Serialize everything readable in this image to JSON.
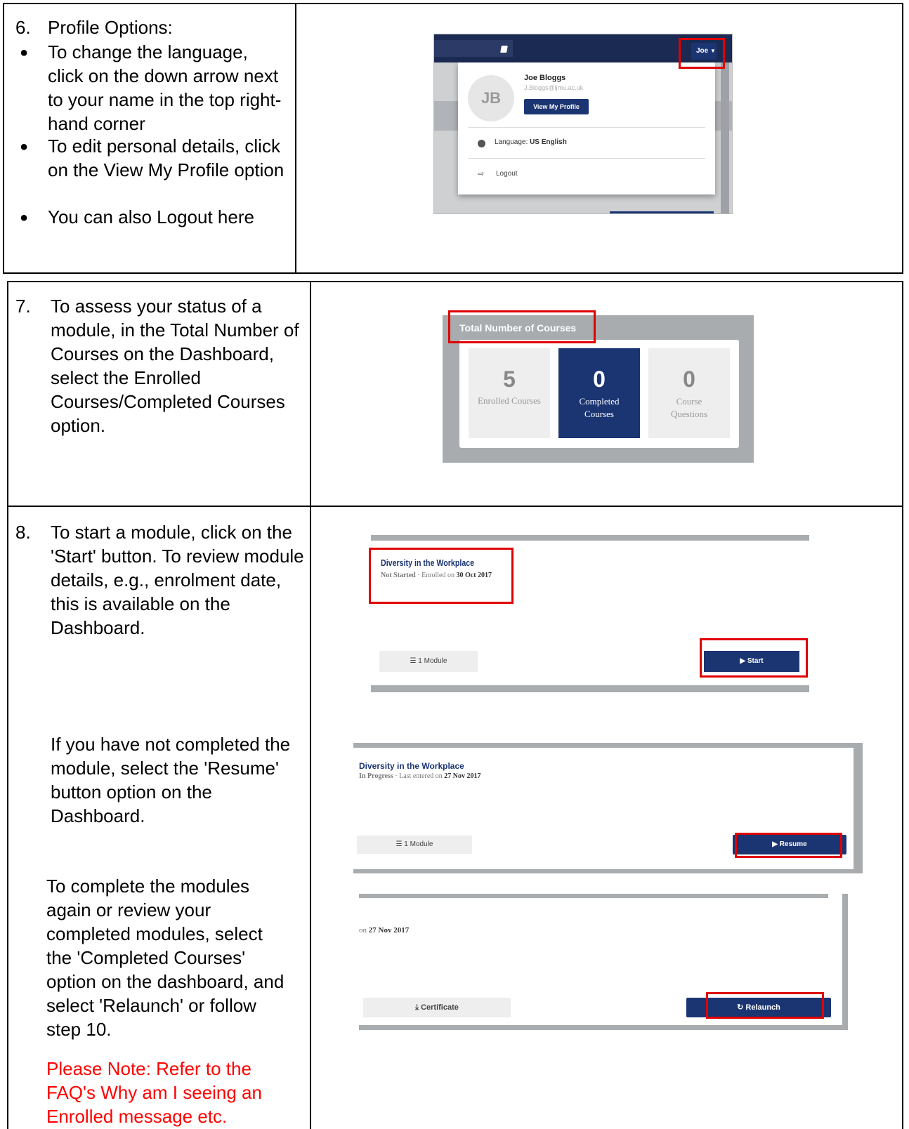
{
  "row6": {
    "number": "6.",
    "heading": "Profile Options:",
    "bullets": [
      "To change the language, click on the down arrow next to your name in the top right-hand corner",
      "To edit personal details, click on the View My Profile option",
      "You can also Logout here"
    ],
    "shot": {
      "user_button": "Joe",
      "avatar_initials": "JB",
      "user_name": "Joe Bloggs",
      "user_email": "J.Bloggs@ljmu.ac.uk",
      "view_profile": "View My Profile",
      "language_label": "Language:",
      "language_value": "US English",
      "logout": "Logout"
    }
  },
  "row7": {
    "number": "7.",
    "text": "To assess your status of a module, in the Total Number of Courses on the Dashboard, select the Enrolled Courses/Completed Courses option.",
    "shot": {
      "title": "Total Number of Courses",
      "tiles": [
        {
          "value": "5",
          "label": "Enrolled Courses"
        },
        {
          "value": "0",
          "label": "Completed Courses"
        },
        {
          "value": "0",
          "label": "Course Questions"
        }
      ]
    }
  },
  "row8": {
    "number": "8.",
    "para1": "To start a module, click on the 'Start' button. To review module details, e.g., enrolment date, this is available on the Dashboard.",
    "para2": "If you have not completed the module, select the 'Resume' button option on the Dashboard.",
    "para3": "To complete the modules again or review your completed modules, select the 'Completed Courses' option on the dashboard, and select 'Relaunch' or follow step 10.",
    "note": "Please Note: Refer to the FAQ's Why am I seeing an Enrolled message etc.",
    "shot1": {
      "course_title": "Diversity in the Workplace",
      "status": "Not Started",
      "enrolled_prefix": "Enrolled on",
      "enrolled_date": "30 Oct 2017",
      "modules": "1 Module",
      "start": "Start"
    },
    "shot2": {
      "course_title": "Diversity in the Workplace",
      "status": "In Progress",
      "entered_prefix": "Last entered on",
      "entered_date": "27 Nov 2017",
      "modules": "1 Module",
      "resume": "Resume"
    },
    "shot3": {
      "date_prefix": "on",
      "date": "27 Nov 2017",
      "certificate": "Certificate",
      "relaunch": "Relaunch"
    }
  },
  "colors": {
    "navy": "#1b3573",
    "highlight": "#e00000",
    "note": "#ff0000"
  }
}
